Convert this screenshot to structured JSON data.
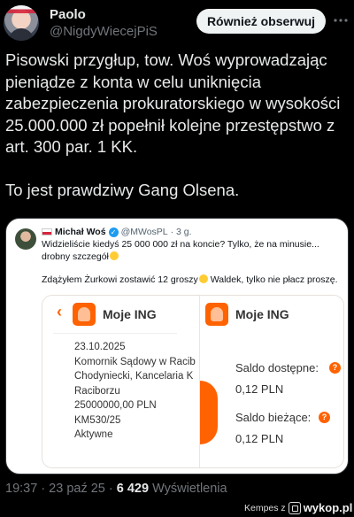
{
  "author": {
    "name": "Paolo",
    "handle": "@NigdyWiecejPiS",
    "follow_label": "Również obserwuj",
    "more_icon": "more-horizontal-icon"
  },
  "tweet": {
    "paragraph1": "Pisowski przygłup, tow. Woś wyprowadzając pieniądze z konta w celu uniknięcia zabezpieczenia prokuratorskiego w wysokości 25.000.000 zł popełnił kolejne przestępstwo z art. 300 par. 1 KK.",
    "paragraph2": "To jest prawdziwy Gang Olsena."
  },
  "quote": {
    "name": "Michał Woś",
    "handle": "@MWosPL",
    "time": "· 3 g.",
    "text1": "Widzieliście kiedyś 25 000 000 zł na koncie? Tylko, że na minusie... drobny szczegół",
    "text2": "Zdążyłem Żurkowi zostawić 12 groszy",
    "text2b": "Waldek, tylko nie płacz proszę.",
    "screenshot": {
      "app_title_left": "Moje ING",
      "app_title_right": "Moje ING",
      "details": [
        "23.10.2025",
        "Komornik Sądowy w Racib",
        "Chodyniecki, Kancelaria K",
        "Raciborzu",
        "25000000,00 PLN",
        "KM530/25",
        "Aktywne"
      ],
      "saldo_dostepne_label": "Saldo dostępne:",
      "saldo_dostepne_value": "0,12 PLN",
      "saldo_biezace_label": "Saldo bieżące:",
      "saldo_biezace_value": "0,12 PLN",
      "info_mark": "?",
      "accent_color": "#ff6200"
    }
  },
  "footer": {
    "time": "19:37 · 23 paź 25 ·",
    "views_count": "6 429",
    "views_label": "Wyświetlenia"
  },
  "watermark": {
    "prefix": "Kempes z",
    "brand": "wykop.pl"
  }
}
